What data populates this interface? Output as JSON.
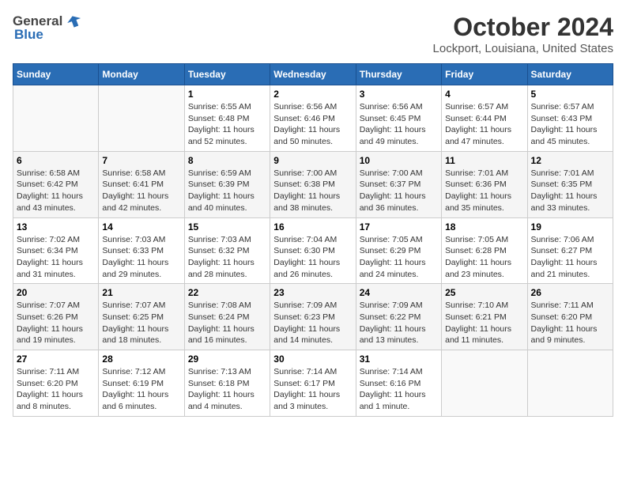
{
  "logo": {
    "general": "General",
    "blue": "Blue"
  },
  "title": "October 2024",
  "location": "Lockport, Louisiana, United States",
  "days_header": [
    "Sunday",
    "Monday",
    "Tuesday",
    "Wednesday",
    "Thursday",
    "Friday",
    "Saturday"
  ],
  "weeks": [
    [
      {
        "day": "",
        "sunrise": "",
        "sunset": "",
        "daylight": ""
      },
      {
        "day": "",
        "sunrise": "",
        "sunset": "",
        "daylight": ""
      },
      {
        "day": "1",
        "sunrise": "Sunrise: 6:55 AM",
        "sunset": "Sunset: 6:48 PM",
        "daylight": "Daylight: 11 hours and 52 minutes."
      },
      {
        "day": "2",
        "sunrise": "Sunrise: 6:56 AM",
        "sunset": "Sunset: 6:46 PM",
        "daylight": "Daylight: 11 hours and 50 minutes."
      },
      {
        "day": "3",
        "sunrise": "Sunrise: 6:56 AM",
        "sunset": "Sunset: 6:45 PM",
        "daylight": "Daylight: 11 hours and 49 minutes."
      },
      {
        "day": "4",
        "sunrise": "Sunrise: 6:57 AM",
        "sunset": "Sunset: 6:44 PM",
        "daylight": "Daylight: 11 hours and 47 minutes."
      },
      {
        "day": "5",
        "sunrise": "Sunrise: 6:57 AM",
        "sunset": "Sunset: 6:43 PM",
        "daylight": "Daylight: 11 hours and 45 minutes."
      }
    ],
    [
      {
        "day": "6",
        "sunrise": "Sunrise: 6:58 AM",
        "sunset": "Sunset: 6:42 PM",
        "daylight": "Daylight: 11 hours and 43 minutes."
      },
      {
        "day": "7",
        "sunrise": "Sunrise: 6:58 AM",
        "sunset": "Sunset: 6:41 PM",
        "daylight": "Daylight: 11 hours and 42 minutes."
      },
      {
        "day": "8",
        "sunrise": "Sunrise: 6:59 AM",
        "sunset": "Sunset: 6:39 PM",
        "daylight": "Daylight: 11 hours and 40 minutes."
      },
      {
        "day": "9",
        "sunrise": "Sunrise: 7:00 AM",
        "sunset": "Sunset: 6:38 PM",
        "daylight": "Daylight: 11 hours and 38 minutes."
      },
      {
        "day": "10",
        "sunrise": "Sunrise: 7:00 AM",
        "sunset": "Sunset: 6:37 PM",
        "daylight": "Daylight: 11 hours and 36 minutes."
      },
      {
        "day": "11",
        "sunrise": "Sunrise: 7:01 AM",
        "sunset": "Sunset: 6:36 PM",
        "daylight": "Daylight: 11 hours and 35 minutes."
      },
      {
        "day": "12",
        "sunrise": "Sunrise: 7:01 AM",
        "sunset": "Sunset: 6:35 PM",
        "daylight": "Daylight: 11 hours and 33 minutes."
      }
    ],
    [
      {
        "day": "13",
        "sunrise": "Sunrise: 7:02 AM",
        "sunset": "Sunset: 6:34 PM",
        "daylight": "Daylight: 11 hours and 31 minutes."
      },
      {
        "day": "14",
        "sunrise": "Sunrise: 7:03 AM",
        "sunset": "Sunset: 6:33 PM",
        "daylight": "Daylight: 11 hours and 29 minutes."
      },
      {
        "day": "15",
        "sunrise": "Sunrise: 7:03 AM",
        "sunset": "Sunset: 6:32 PM",
        "daylight": "Daylight: 11 hours and 28 minutes."
      },
      {
        "day": "16",
        "sunrise": "Sunrise: 7:04 AM",
        "sunset": "Sunset: 6:30 PM",
        "daylight": "Daylight: 11 hours and 26 minutes."
      },
      {
        "day": "17",
        "sunrise": "Sunrise: 7:05 AM",
        "sunset": "Sunset: 6:29 PM",
        "daylight": "Daylight: 11 hours and 24 minutes."
      },
      {
        "day": "18",
        "sunrise": "Sunrise: 7:05 AM",
        "sunset": "Sunset: 6:28 PM",
        "daylight": "Daylight: 11 hours and 23 minutes."
      },
      {
        "day": "19",
        "sunrise": "Sunrise: 7:06 AM",
        "sunset": "Sunset: 6:27 PM",
        "daylight": "Daylight: 11 hours and 21 minutes."
      }
    ],
    [
      {
        "day": "20",
        "sunrise": "Sunrise: 7:07 AM",
        "sunset": "Sunset: 6:26 PM",
        "daylight": "Daylight: 11 hours and 19 minutes."
      },
      {
        "day": "21",
        "sunrise": "Sunrise: 7:07 AM",
        "sunset": "Sunset: 6:25 PM",
        "daylight": "Daylight: 11 hours and 18 minutes."
      },
      {
        "day": "22",
        "sunrise": "Sunrise: 7:08 AM",
        "sunset": "Sunset: 6:24 PM",
        "daylight": "Daylight: 11 hours and 16 minutes."
      },
      {
        "day": "23",
        "sunrise": "Sunrise: 7:09 AM",
        "sunset": "Sunset: 6:23 PM",
        "daylight": "Daylight: 11 hours and 14 minutes."
      },
      {
        "day": "24",
        "sunrise": "Sunrise: 7:09 AM",
        "sunset": "Sunset: 6:22 PM",
        "daylight": "Daylight: 11 hours and 13 minutes."
      },
      {
        "day": "25",
        "sunrise": "Sunrise: 7:10 AM",
        "sunset": "Sunset: 6:21 PM",
        "daylight": "Daylight: 11 hours and 11 minutes."
      },
      {
        "day": "26",
        "sunrise": "Sunrise: 7:11 AM",
        "sunset": "Sunset: 6:20 PM",
        "daylight": "Daylight: 11 hours and 9 minutes."
      }
    ],
    [
      {
        "day": "27",
        "sunrise": "Sunrise: 7:11 AM",
        "sunset": "Sunset: 6:20 PM",
        "daylight": "Daylight: 11 hours and 8 minutes."
      },
      {
        "day": "28",
        "sunrise": "Sunrise: 7:12 AM",
        "sunset": "Sunset: 6:19 PM",
        "daylight": "Daylight: 11 hours and 6 minutes."
      },
      {
        "day": "29",
        "sunrise": "Sunrise: 7:13 AM",
        "sunset": "Sunset: 6:18 PM",
        "daylight": "Daylight: 11 hours and 4 minutes."
      },
      {
        "day": "30",
        "sunrise": "Sunrise: 7:14 AM",
        "sunset": "Sunset: 6:17 PM",
        "daylight": "Daylight: 11 hours and 3 minutes."
      },
      {
        "day": "31",
        "sunrise": "Sunrise: 7:14 AM",
        "sunset": "Sunset: 6:16 PM",
        "daylight": "Daylight: 11 hours and 1 minute."
      },
      {
        "day": "",
        "sunrise": "",
        "sunset": "",
        "daylight": ""
      },
      {
        "day": "",
        "sunrise": "",
        "sunset": "",
        "daylight": ""
      }
    ]
  ]
}
